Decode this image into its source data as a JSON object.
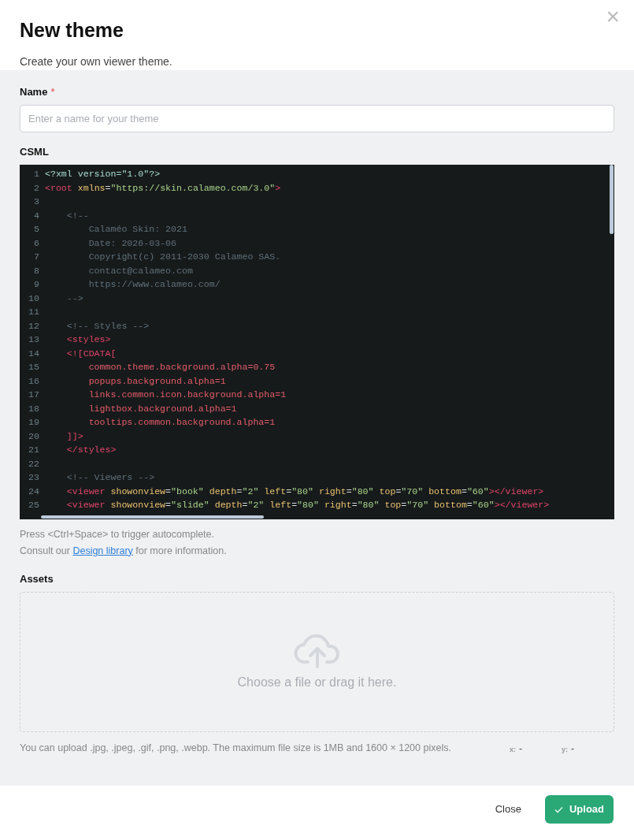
{
  "dialog": {
    "title": "New theme",
    "subtitle": "Create your own viewer theme.",
    "close_icon": "×"
  },
  "name_field": {
    "label": "Name",
    "required_mark": "*",
    "placeholder": "Enter a name for your theme"
  },
  "csml": {
    "label": "CSML",
    "lines": [
      {
        "number": "1",
        "tokens": [
          {
            "kind": "meta",
            "text": "<?xml version=\"1.0\"?>"
          }
        ]
      },
      {
        "number": "2",
        "tokens": [
          {
            "kind": "tag",
            "text": "<root"
          },
          {
            "kind": "attr",
            "text": " xmlns"
          },
          {
            "kind": "punct",
            "text": "="
          },
          {
            "kind": "string",
            "text": "\"https://skin.calameo.com/3.0\""
          },
          {
            "kind": "tag",
            "text": ">"
          }
        ]
      },
      {
        "number": "3"
      },
      {
        "number": "4",
        "tokens": [
          {
            "kind": "comment",
            "text": "    <!--"
          }
        ]
      },
      {
        "number": "5",
        "tokens": [
          {
            "kind": "comment",
            "text": "        Calaméo Skin: 2021"
          }
        ]
      },
      {
        "number": "6",
        "tokens": [
          {
            "kind": "comment",
            "text": "        Date: 2026-03-06"
          }
        ]
      },
      {
        "number": "7",
        "tokens": [
          {
            "kind": "comment",
            "text": "        Copyright(c) 2011-2030 Calameo SAS."
          }
        ]
      },
      {
        "number": "8",
        "tokens": [
          {
            "kind": "comment",
            "text": "        contact@calameo.com"
          }
        ]
      },
      {
        "number": "9",
        "tokens": [
          {
            "kind": "comment",
            "text": "        https://www.calameo.com/"
          }
        ]
      },
      {
        "number": "10",
        "tokens": [
          {
            "kind": "comment",
            "text": "    -->"
          }
        ]
      },
      {
        "number": "11"
      },
      {
        "number": "12",
        "tokens": [
          {
            "kind": "comment",
            "text": "    <!-- Styles -->"
          }
        ]
      },
      {
        "number": "13",
        "tokens": [
          {
            "kind": "tag",
            "text": "    <styles>"
          }
        ]
      },
      {
        "number": "14",
        "tokens": [
          {
            "kind": "tag",
            "text": "    <![CDATA["
          }
        ]
      },
      {
        "number": "15",
        "tokens": [
          {
            "kind": "cdata",
            "text": "        common.theme.background.alpha=0.75"
          }
        ]
      },
      {
        "number": "16",
        "tokens": [
          {
            "kind": "cdata",
            "text": "        popups.background.alpha=1"
          }
        ]
      },
      {
        "number": "17",
        "tokens": [
          {
            "kind": "cdata",
            "text": "        links.common.icon.background.alpha=1"
          }
        ]
      },
      {
        "number": "18",
        "tokens": [
          {
            "kind": "cdata",
            "text": "        lightbox.background.alpha=1"
          }
        ]
      },
      {
        "number": "19",
        "tokens": [
          {
            "kind": "cdata",
            "text": "        tooltips.common.background.alpha=1"
          }
        ]
      },
      {
        "number": "20",
        "tokens": [
          {
            "kind": "tag",
            "text": "    ]]>"
          }
        ]
      },
      {
        "number": "21",
        "tokens": [
          {
            "kind": "tag",
            "text": "    </styles>"
          }
        ]
      },
      {
        "number": "22"
      },
      {
        "number": "23",
        "tokens": [
          {
            "kind": "comment",
            "text": "    <!-- Viewers -->"
          }
        ]
      },
      {
        "number": "24",
        "tokens": [
          {
            "kind": "tag",
            "text": "    <viewer"
          },
          {
            "kind": "attr",
            "text": " showonview"
          },
          {
            "kind": "punct",
            "text": "="
          },
          {
            "kind": "string",
            "text": "\"book\""
          },
          {
            "kind": "attr",
            "text": " depth"
          },
          {
            "kind": "punct",
            "text": "="
          },
          {
            "kind": "string",
            "text": "\"2\""
          },
          {
            "kind": "attr",
            "text": " left"
          },
          {
            "kind": "punct",
            "text": "="
          },
          {
            "kind": "string",
            "text": "\"80\""
          },
          {
            "kind": "attr",
            "text": " right"
          },
          {
            "kind": "punct",
            "text": "="
          },
          {
            "kind": "string",
            "text": "\"80\""
          },
          {
            "kind": "attr",
            "text": " top"
          },
          {
            "kind": "punct",
            "text": "="
          },
          {
            "kind": "string",
            "text": "\"70\""
          },
          {
            "kind": "attr",
            "text": " bottom"
          },
          {
            "kind": "punct",
            "text": "="
          },
          {
            "kind": "string",
            "text": "\"60\""
          },
          {
            "kind": "tag",
            "text": "></viewer>"
          }
        ]
      },
      {
        "number": "25",
        "tokens": [
          {
            "kind": "tag",
            "text": "    <viewer"
          },
          {
            "kind": "attr",
            "text": " showonview"
          },
          {
            "kind": "punct",
            "text": "="
          },
          {
            "kind": "string",
            "text": "\"slide\""
          },
          {
            "kind": "attr",
            "text": " depth"
          },
          {
            "kind": "punct",
            "text": "="
          },
          {
            "kind": "string",
            "text": "\"2\""
          },
          {
            "kind": "attr",
            "text": " left"
          },
          {
            "kind": "punct",
            "text": "="
          },
          {
            "kind": "string",
            "text": "\"80\""
          },
          {
            "kind": "attr",
            "text": " right"
          },
          {
            "kind": "punct",
            "text": "="
          },
          {
            "kind": "string",
            "text": "\"80\""
          },
          {
            "kind": "attr",
            "text": " top"
          },
          {
            "kind": "punct",
            "text": "="
          },
          {
            "kind": "string",
            "text": "\"70\""
          },
          {
            "kind": "attr",
            "text": " bottom"
          },
          {
            "kind": "punct",
            "text": "="
          },
          {
            "kind": "string",
            "text": "\"60\""
          },
          {
            "kind": "tag",
            "text": "></viewer>"
          }
        ]
      }
    ],
    "hint": "Press <Ctrl+Space> to trigger autocomplete.",
    "consult": {
      "before": "Consult our ",
      "link": "Design library",
      "after": " for more information."
    }
  },
  "assets": {
    "label": "Assets",
    "dropzone_text": "Choose a file or drag it here.",
    "note": "You can upload .jpg, .jpeg, .gif, .png, .webp. The maximum file size is 1MB and 1600 × 1200 pixels.",
    "x_label": "x:",
    "x_value": "-",
    "y_label": "y:",
    "y_value": "-"
  },
  "footer": {
    "buttons": [
      {
        "kind": "plain",
        "label": "Close"
      },
      {
        "kind": "primary",
        "label": "Upload"
      }
    ]
  }
}
